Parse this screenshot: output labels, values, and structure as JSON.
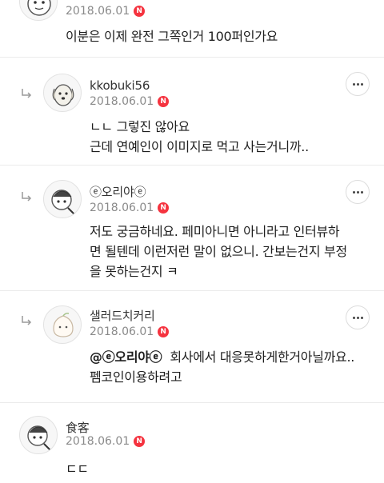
{
  "comments": [
    {
      "nickname": "",
      "date": "2018.06.01",
      "badge": "N",
      "lines": [
        "이분은 이제 완전 그쪽인거 100퍼인가요"
      ],
      "avatar_icon": "cartoon-avatar-icon"
    },
    {
      "nickname": "kkobuki56",
      "date": "2018.06.01",
      "badge": "N",
      "lines": [
        "ㄴㄴ 그렇진 않아요",
        "근데 연예인이 이미지로 먹고 사는거니까.."
      ],
      "avatar_icon": "dog-avatar-icon"
    },
    {
      "nickname": "ⓔ오리야ⓔ",
      "date": "2018.06.01",
      "badge": "N",
      "lines": [
        "저도 궁금하네요. 페미아니면 아니라고 인터뷰하",
        "면 될텐데 이런저런 말이 없으니. 간보는건지 부정",
        "을 못하는건지 ㅋ"
      ],
      "avatar_icon": "cartoon-avatar-icon"
    },
    {
      "nickname": "샐러드치커리",
      "date": "2018.06.01",
      "badge": "N",
      "mention": "@ⓔ오리야ⓔ",
      "lines": [
        "회사에서 대응못하게한거아닐까요..",
        "펨코인이용하려고"
      ],
      "avatar_icon": "peach-avatar-icon"
    },
    {
      "nickname": "食客",
      "date": "2018.06.01",
      "badge": "N",
      "lines": [
        "ㄷㄷ"
      ],
      "avatar_icon": "cartoon-avatar-icon"
    }
  ],
  "more_icon": "more-options-icon",
  "reply_icon": "reply-arrow-icon"
}
